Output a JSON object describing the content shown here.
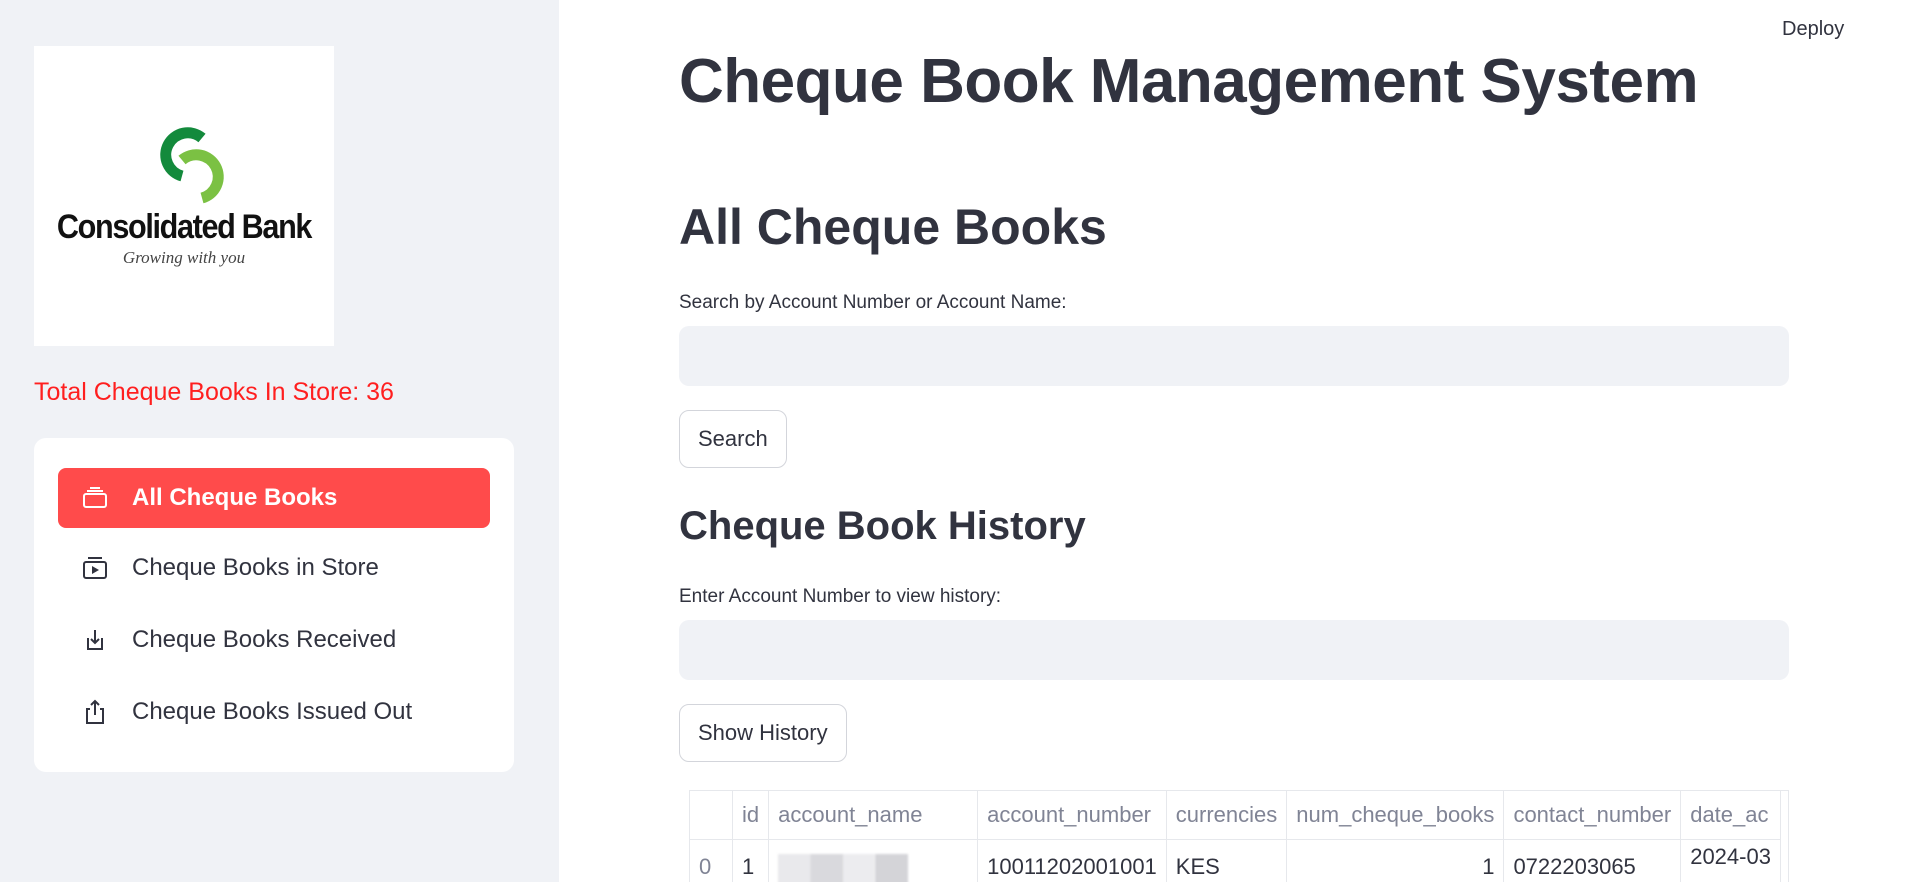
{
  "header": {
    "deploy_label": "Deploy"
  },
  "sidebar": {
    "logo": {
      "name": "Consolidated Bank",
      "tagline": "Growing with you",
      "colors": [
        "#138a3c",
        "#7bc143"
      ]
    },
    "store_total": "Total Cheque Books In Store: 36",
    "store_total_color": "#ff1f1f",
    "nav": [
      {
        "label": "All Cheque Books",
        "icon": "stack-icon",
        "active": true
      },
      {
        "label": "Cheque Books in Store",
        "icon": "store-play-icon",
        "active": false
      },
      {
        "label": "Cheque Books Received",
        "icon": "download-box-icon",
        "active": false
      },
      {
        "label": "Cheque Books Issued Out",
        "icon": "upload-share-icon",
        "active": false
      }
    ],
    "accent_color": "#ff4b4b"
  },
  "main": {
    "title": "Cheque Book Management System",
    "all_section": {
      "heading": "All Cheque Books",
      "search_label": "Search by Account Number or Account Name:",
      "search_value": "",
      "search_button": "Search"
    },
    "history_section": {
      "heading": "Cheque Book History",
      "input_label": "Enter Account Number to view history:",
      "input_value": "",
      "button": "Show History"
    },
    "table": {
      "columns": [
        "",
        "id",
        "account_name",
        "account_number",
        "currencies",
        "num_cheque_books",
        "contact_number",
        "date_ac"
      ],
      "rows": [
        {
          "index": "0",
          "id": "1",
          "account_name": "",
          "account_number": "10011202001001",
          "currencies": "KES",
          "num_cheque_books": "1",
          "contact_number": "0722203065",
          "date": "2024-03"
        }
      ]
    }
  }
}
